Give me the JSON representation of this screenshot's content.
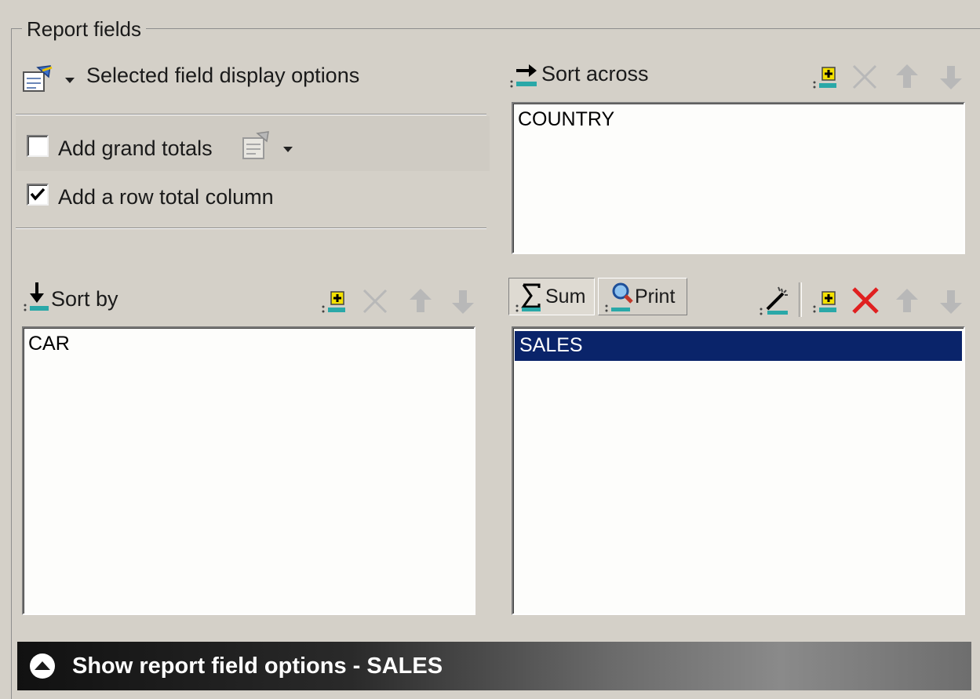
{
  "group": {
    "title": "Report fields"
  },
  "display_options": {
    "label": "Selected field display options"
  },
  "totals": {
    "grand_totals_label": "Add grand totals",
    "grand_totals_checked": false,
    "row_total_label": "Add a row total column",
    "row_total_checked": true
  },
  "sort_across": {
    "label": "Sort across",
    "items": [
      "COUNTRY"
    ]
  },
  "sort_by": {
    "label": "Sort by",
    "items": [
      "CAR"
    ]
  },
  "measures": {
    "sum_label": "Sum",
    "print_label": "Print",
    "items": [
      "SALES"
    ],
    "selected_item": "SALES"
  },
  "bottom_bar": {
    "label": "Show report field options - SALES"
  },
  "colors": {
    "selection": "#0a246a",
    "delete_active": "#e02020",
    "add_plus": "#e8d000"
  }
}
